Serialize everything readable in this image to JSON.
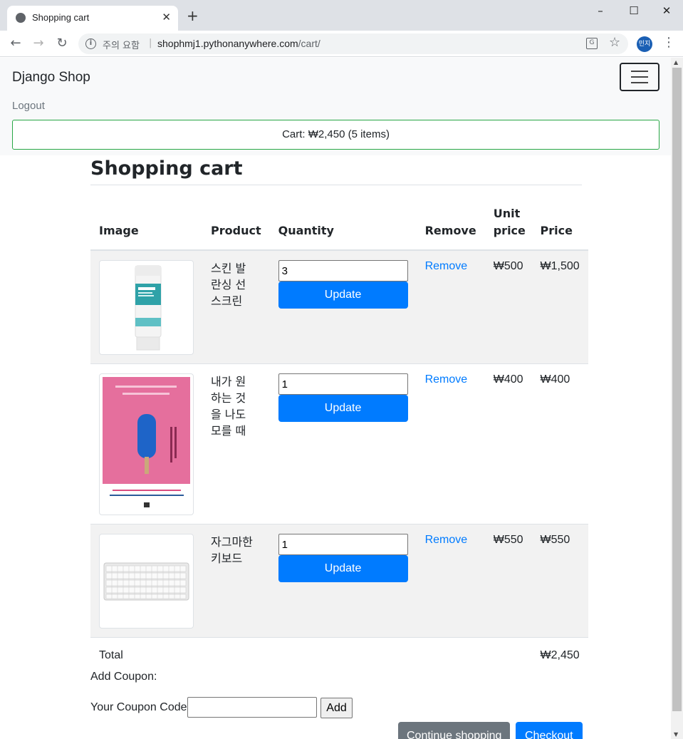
{
  "browser": {
    "tab_title": "Shopping cart",
    "new_tab_label": "+",
    "close_tab_label": "✕",
    "security_label": "주의 요함",
    "url_host": "shophmj1.pythonanywhere.com",
    "url_path": "/cart/",
    "profile_initials": "민지",
    "window_controls": {
      "minimize": "–",
      "maximize": "☐",
      "close": "✕"
    }
  },
  "navbar": {
    "brand": "Django Shop",
    "logout": "Logout",
    "cart_summary": "Cart: ₩2,450 (5 items)"
  },
  "main": {
    "title": "Shopping cart",
    "table": {
      "headers": {
        "image": "Image",
        "product": "Product",
        "quantity": "Quantity",
        "remove": "Remove",
        "unit_price": "Unit price",
        "price": "Price"
      },
      "rows": [
        {
          "product": "스킨 발란싱 선스크린",
          "quantity": "3",
          "update": "Update",
          "remove": "Remove",
          "unit_price": "₩500",
          "price": "₩1,500",
          "image_icon": "sunscreen-tube-image"
        },
        {
          "product": "내가 원하는 것을 나도 모를 때",
          "quantity": "1",
          "update": "Update",
          "remove": "Remove",
          "unit_price": "₩400",
          "price": "₩400",
          "image_icon": "book-cover-image"
        },
        {
          "product": "자그마한 키보드",
          "quantity": "1",
          "update": "Update",
          "remove": "Remove",
          "unit_price": "₩550",
          "price": "₩550",
          "image_icon": "keyboard-image"
        }
      ],
      "total_label": "Total",
      "total_value": "₩2,450"
    },
    "coupon": {
      "heading": "Add Coupon:",
      "label": "Your Coupon Code:",
      "value": "",
      "add_button": "Add"
    },
    "continue_button": "Continue shopping",
    "checkout_button": "Checkout"
  },
  "colors": {
    "primary": "#007bff",
    "secondary": "#6c757d",
    "success_border": "#28a745",
    "book_pink": "#e56f9d",
    "popsicle_blue": "#1e64c8",
    "tube_teal": "#2fa2a8"
  }
}
